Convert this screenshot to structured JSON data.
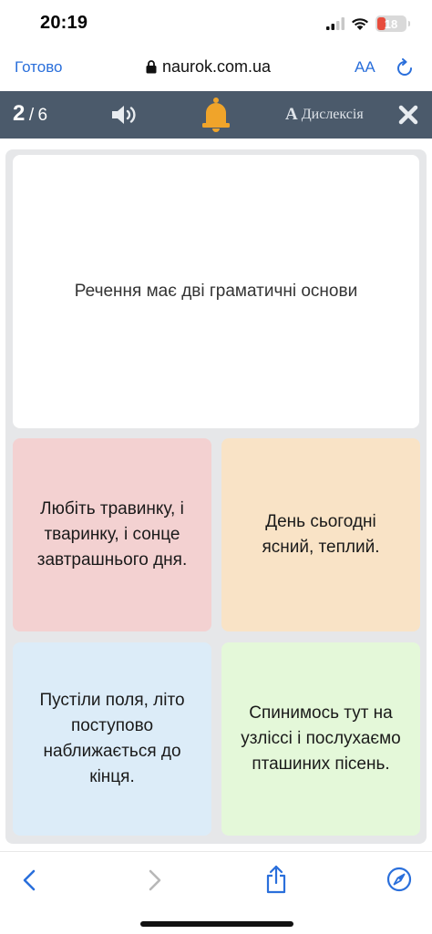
{
  "status_bar": {
    "time": "20:19",
    "battery": "18",
    "icons": [
      "signal-icon",
      "wifi-icon",
      "battery-icon"
    ]
  },
  "browser": {
    "done_label": "Готово",
    "url": "naurok.com.ua",
    "text_size_label": "AA",
    "icons": [
      "lock-icon",
      "reload-icon",
      "back-icon",
      "forward-icon",
      "share-icon",
      "compass-icon"
    ]
  },
  "quiz_header": {
    "current": "2",
    "separator": "/",
    "total": "6",
    "dyslexia_glyph": "A",
    "dyslexia_label": "Дислексія",
    "icons": [
      "sound-icon",
      "bell-icon",
      "close-icon"
    ],
    "colors": {
      "header_bg": "#4b5a6b",
      "bell": "#f0a42a"
    }
  },
  "question": {
    "text": "Речення має дві граматичні основи"
  },
  "options": [
    {
      "text": "Любіть травинку, і тваринку, і сонце завтрашнього дня.",
      "color": "#f3d1d1"
    },
    {
      "text": "День сьогодні ясний, теплий.",
      "color": "#f9e3c6"
    },
    {
      "text": "Пустіли поля, літо поступово наближається до кінця.",
      "color": "#dcecf8"
    },
    {
      "text": "Спинимось тут на узліссі і послухаємо пташиних пісень.",
      "color": "#e4f8d9"
    }
  ]
}
